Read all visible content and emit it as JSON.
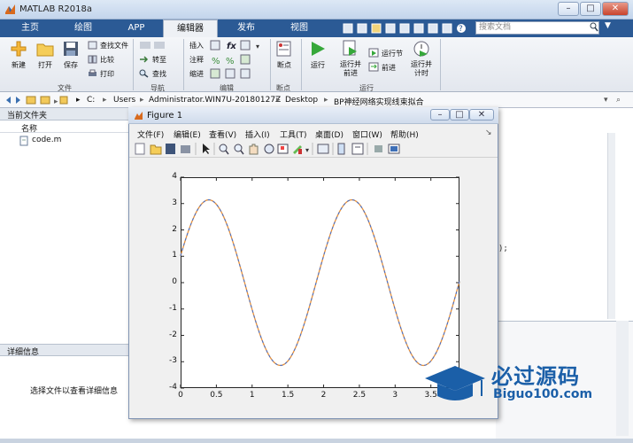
{
  "window": {
    "title": "MATLAB R2018a"
  },
  "tabs": [
    "主页",
    "绘图",
    "APP",
    "编辑器",
    "发布",
    "视图"
  ],
  "active_tab": "编辑器",
  "search": {
    "placeholder": "搜索文档"
  },
  "ribbon": {
    "file": {
      "new": "新建",
      "open": "打开",
      "save": "保存",
      "find_files": "查找文件",
      "compare": "比较",
      "print": "打印",
      "group": "文件"
    },
    "nav": {
      "goto": "转至",
      "find": "查找",
      "group": "导航"
    },
    "edit": {
      "insert": "插入",
      "comment": "注释",
      "indent": "缩进",
      "group": "编辑"
    },
    "breakpoints": {
      "label": "断点",
      "group": "断点"
    },
    "run": {
      "run": "运行",
      "run_advance_1": "运行并",
      "run_advance_2": "前进",
      "run_section": "运行节",
      "advance": "前进",
      "run_time_1": "运行并",
      "run_time_2": "计时",
      "group": "运行"
    }
  },
  "path": [
    "C:",
    "Users",
    "Administrator.WIN7U-20180127Z",
    "Desktop",
    "BP神经网络实现线束拟合"
  ],
  "current_folder": {
    "title": "当前文件夹",
    "col_name": "名称",
    "files": [
      "code.m"
    ]
  },
  "details": {
    "title": "详细信息",
    "empty_msg": "选择文件以查看详细信息"
  },
  "editor_fragment": ");",
  "figure": {
    "title": "Figure 1",
    "menu": [
      "文件(F)",
      "编辑(E)",
      "查看(V)",
      "插入(I)",
      "工具(T)",
      "桌面(D)",
      "窗口(W)",
      "帮助(H)"
    ]
  },
  "chart_data": {
    "type": "line",
    "xlim": [
      0,
      3.9
    ],
    "ylim": [
      -4,
      4
    ],
    "xticks": [
      "0",
      "0.5",
      "1",
      "1.5",
      "2",
      "2.5",
      "3",
      "3.5"
    ],
    "yticks": [
      "4",
      "3",
      "2",
      "1",
      "0",
      "-1",
      "-2",
      "-3",
      "-4"
    ],
    "series": [
      {
        "function": "pi*sin(pi*x/1)+... sampled",
        "x": [
          0,
          0.1,
          0.2,
          0.3,
          0.4,
          0.5,
          0.6,
          0.7,
          0.8,
          0.9,
          1.0,
          1.1,
          1.2,
          1.3,
          1.4,
          1.5,
          1.6,
          1.7,
          1.8,
          1.9,
          2.0,
          2.1,
          2.2,
          2.3,
          2.4,
          2.5,
          2.6,
          2.7,
          2.8,
          2.9,
          3.0,
          3.1,
          3.2,
          3.3,
          3.4,
          3.5,
          3.6,
          3.7,
          3.8,
          3.9
        ],
        "y": [
          1.0,
          1.89,
          2.61,
          3.06,
          3.14,
          2.87,
          2.27,
          1.42,
          0.42,
          -0.62,
          -1.59,
          -2.39,
          -2.92,
          -3.14,
          -3.0,
          -2.53,
          -1.78,
          -0.84,
          0.2,
          1.21,
          2.1,
          2.76,
          3.11,
          3.1,
          2.74,
          2.07,
          1.17,
          0.15,
          -0.88,
          -1.83,
          -2.56,
          -3.02,
          -3.14,
          -2.9,
          -2.32,
          -1.49,
          -0.49,
          0.56,
          1.53,
          2.35
        ],
        "color": "#e8913a"
      },
      {
        "x_ref": 0,
        "color": "#3d6fd4",
        "style": "dashed"
      }
    ]
  },
  "watermark": {
    "brand": "必过源码",
    "url": "Biguo100.com"
  },
  "colors": {
    "tabbar": "#2b5a95",
    "accent_line": "#e8913a",
    "accent_dash": "#3d6fd4"
  }
}
